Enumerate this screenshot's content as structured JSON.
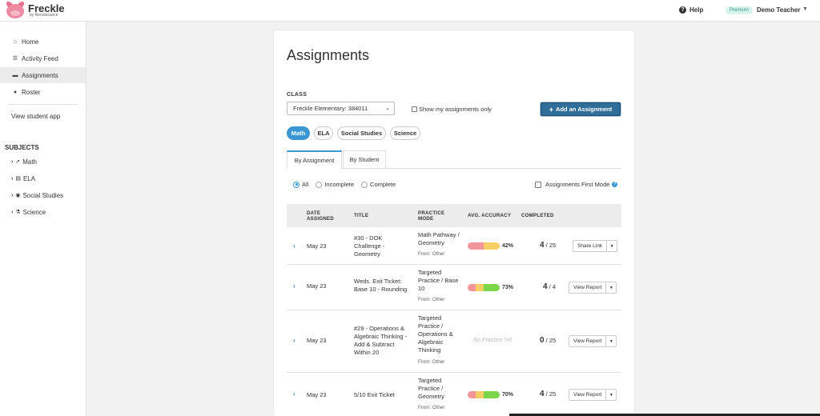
{
  "app": {
    "logo_name": "Freckle",
    "logo_sub": "by Renaissance",
    "help_label": "Help",
    "plan_badge": "Premium",
    "user_name": "Demo Teacher"
  },
  "sidebar": {
    "items": [
      {
        "label": "Home",
        "icon": "home-icon"
      },
      {
        "label": "Activity Feed",
        "icon": "list-icon"
      },
      {
        "label": "Assignments",
        "icon": "briefcase-icon"
      },
      {
        "label": "Roster",
        "icon": "users-icon"
      }
    ],
    "student_app": "View student app",
    "subjects_title": "SUBJECTS",
    "subjects": [
      {
        "label": "Math",
        "icon": "rocket-icon"
      },
      {
        "label": "ELA",
        "icon": "book-icon"
      },
      {
        "label": "Social Studies",
        "icon": "globe-icon"
      },
      {
        "label": "Science",
        "icon": "flask-icon"
      }
    ]
  },
  "main": {
    "title": "Assignments",
    "class_label": "CLASS",
    "class_value": "Freckle Elementary: 384011",
    "my_assignments_only": "Show my assignments only",
    "add_button": "Add an Assignment",
    "subject_pills": [
      "Math",
      "ELA",
      "Social Studies",
      "Science"
    ],
    "active_pill": "Math",
    "tabs": [
      "By Assignment",
      "By Student"
    ],
    "active_tab": "By Assignment",
    "filters": [
      "All",
      "Incomplete",
      "Complete"
    ],
    "active_filter": "All",
    "assignments_first_mode": "Assignments First Mode",
    "help_glyph": "?"
  },
  "table": {
    "headers": {
      "date": "DATE ASSIGNED",
      "title": "TITLE",
      "mode": "PRACTICE MODE",
      "accuracy": "AVG. ACCURACY",
      "completed": "COMPLETED"
    },
    "rows": [
      {
        "date": "May 23",
        "title": "#30 - DOK Challenge - Geometry",
        "mode": "Math Pathway / Geometry",
        "from": "From: Other",
        "accuracy_label": "42%",
        "accuracy_segments": [
          0.5,
          0.5,
          0
        ],
        "completed_num": "4",
        "completed_total": "/ 25",
        "action": "Share Link"
      },
      {
        "date": "May 23",
        "title": "Weds. Exit Ticket: Base 10 - Rounding",
        "mode": "Targeted Practice / Base 10",
        "from": "From: Other",
        "accuracy_label": "73%",
        "accuracy_segments": [
          0.25,
          0.25,
          0.5
        ],
        "completed_num": "4",
        "completed_total": "/ 4",
        "action": "View Report"
      },
      {
        "date": "May 23",
        "title": "#29 - Operations & Algebraic Thinking - Add & Subtract Within 20",
        "mode": "Targeted Practice / Operations & Algebraic Thinking",
        "from": "From: Other",
        "no_practice": "No Practice Yet",
        "completed_num": "0",
        "completed_total": "/ 25",
        "action": "View Report"
      },
      {
        "date": "May 23",
        "title": "5/10 Exit Ticket",
        "mode": "Targeted Practice / Geometry",
        "from": "From: Other",
        "accuracy_label": "70%",
        "accuracy_segments": [
          0.25,
          0.25,
          0.5
        ],
        "completed_num": "4",
        "completed_total": "/ 25",
        "action": "View Report"
      }
    ]
  },
  "colors": {
    "accent": "#3a97d3",
    "primary_button": "#2f6e99",
    "acc_red": "#f2959b",
    "acc_yellow": "#f5cf66",
    "acc_green": "#7bd44a"
  }
}
